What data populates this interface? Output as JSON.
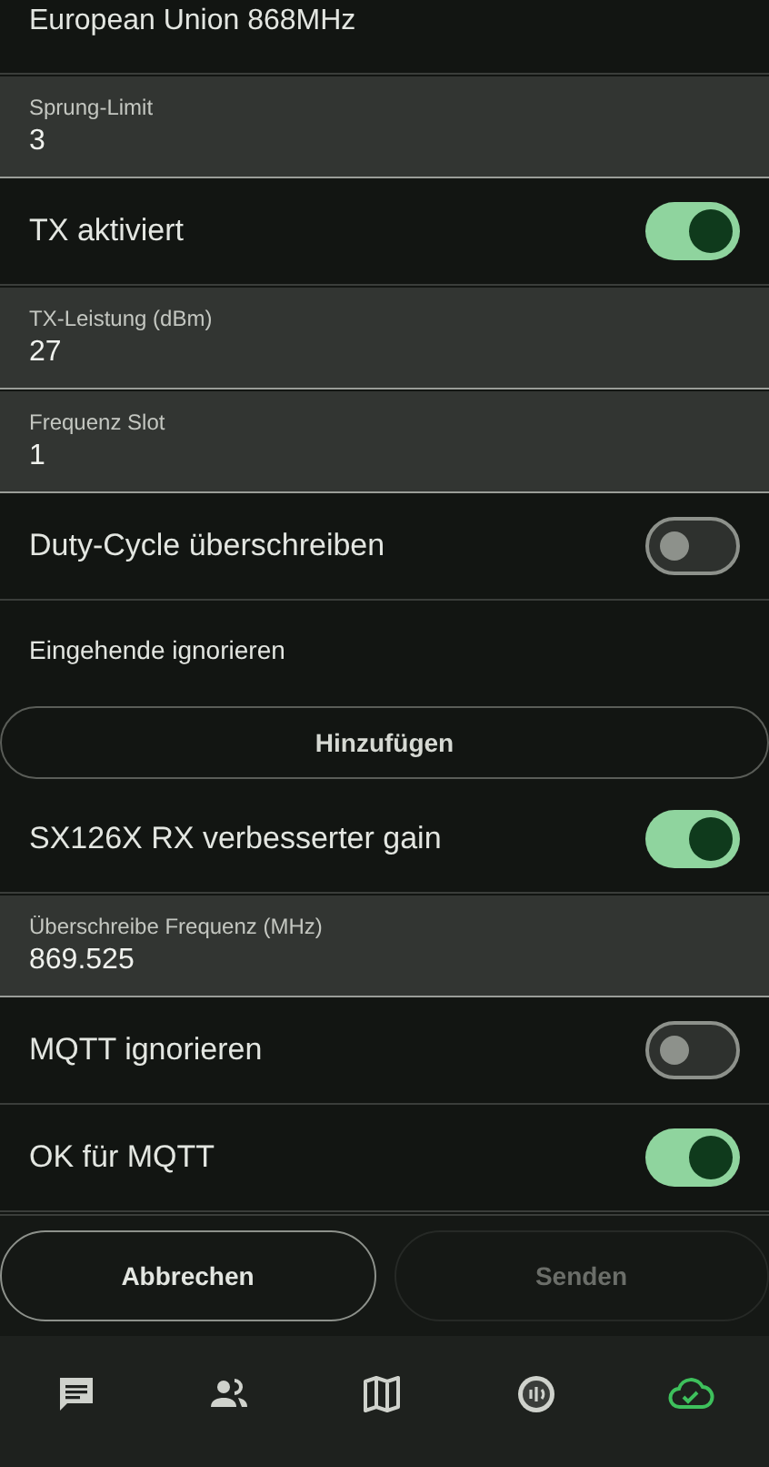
{
  "header_value": "European Union 868MHz",
  "items": [
    {
      "kind": "field",
      "label": "Sprung-Limit",
      "value": "3"
    },
    {
      "kind": "switch",
      "label": "TX aktiviert",
      "on": true
    },
    {
      "kind": "field",
      "label": "TX-Leistung (dBm)",
      "value": "27"
    },
    {
      "kind": "field",
      "label": "Frequenz Slot",
      "value": "1"
    },
    {
      "kind": "switch",
      "label": "Duty-Cycle überschreiben",
      "on": false
    },
    {
      "kind": "label",
      "label": "Eingehende ignorieren"
    },
    {
      "kind": "button",
      "label": "Hinzufügen"
    },
    {
      "kind": "switch",
      "label": "SX126X RX verbesserter gain",
      "on": true
    },
    {
      "kind": "field",
      "label": "Überschreibe Frequenz (MHz)",
      "value": "869.525"
    },
    {
      "kind": "switch",
      "label": "MQTT ignorieren",
      "on": false
    },
    {
      "kind": "switch",
      "label": "OK für MQTT",
      "on": true
    }
  ],
  "actions": [
    {
      "label": "Abbrechen",
      "disabled": false
    },
    {
      "label": "Senden",
      "disabled": true
    }
  ],
  "nav": [
    {
      "kind": "messages",
      "selected": false
    },
    {
      "kind": "contacts",
      "selected": false
    },
    {
      "kind": "map",
      "selected": false
    },
    {
      "kind": "nodes",
      "selected": false
    },
    {
      "kind": "connection",
      "selected": true
    }
  ]
}
